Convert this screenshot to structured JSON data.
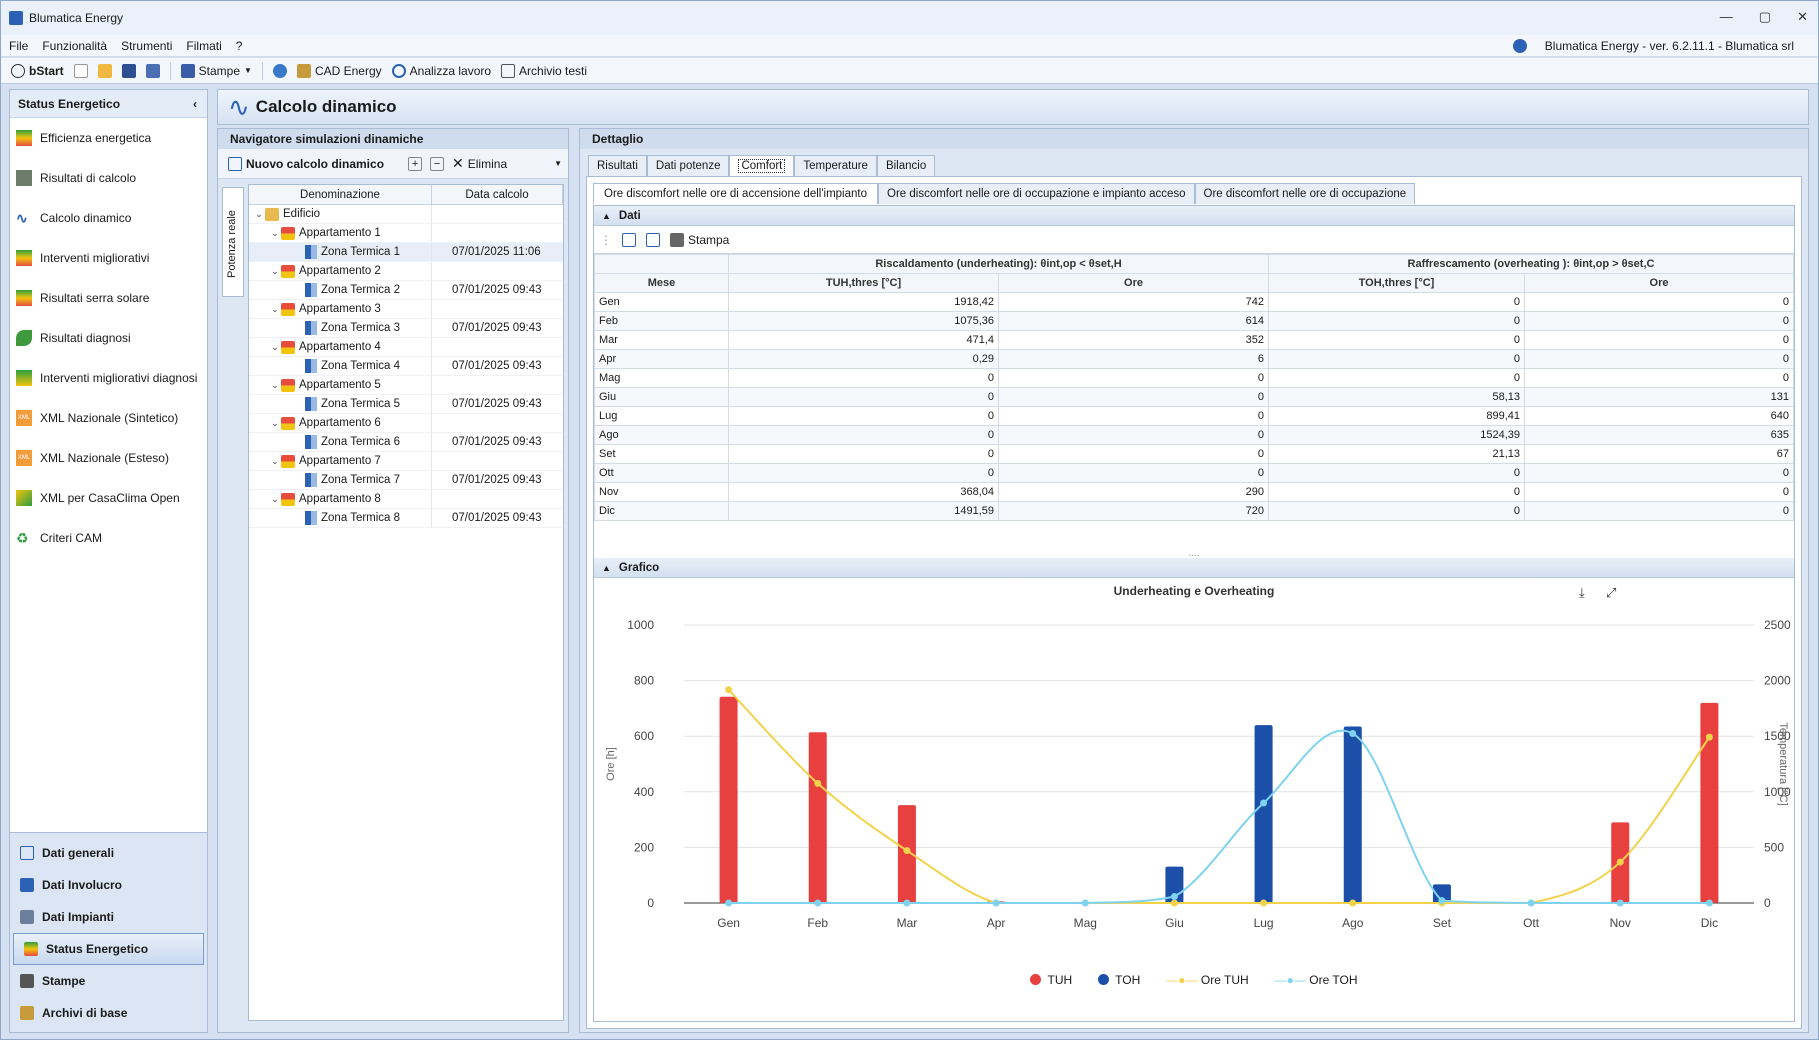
{
  "app": {
    "title": "Blumatica Energy",
    "version": "Blumatica Energy - ver. 6.2.11.1 - Blumatica srl"
  },
  "menu": [
    "File",
    "Funzionalità",
    "Strumenti",
    "Filmati",
    "?"
  ],
  "toolbar": {
    "bstart": "bStart",
    "stampe": "Stampe",
    "cad": "CAD Energy",
    "analizza": "Analizza lavoro",
    "archivio": "Archivio testi"
  },
  "sidebar": {
    "title": "Status Energetico",
    "items": [
      "Efficienza energetica",
      "Risultati di calcolo",
      "Calcolo dinamico",
      "Interventi migliorativi",
      "Risultati serra solare",
      "Risultati diagnosi",
      "Interventi migliorativi diagnosi",
      "XML Nazionale (Sintetico)",
      "XML Nazionale (Esteso)",
      "XML per CasaClima Open",
      "Criteri CAM"
    ],
    "bottom": [
      "Dati generali",
      "Dati Involucro",
      "Dati Impianti",
      "Status Energetico",
      "Stampe",
      "Archivi di base"
    ]
  },
  "main": {
    "title": "Calcolo dinamico"
  },
  "nav": {
    "title": "Navigatore simulazioni dinamiche",
    "new_btn": "Nuovo calcolo dinamico",
    "delete_btn": "Elimina",
    "vertical_tab": "Potenza reale",
    "col_name": "Denominazione",
    "col_date": "Data calcolo",
    "root": "Edificio",
    "apartments": [
      {
        "name": "Appartamento 1",
        "zone": "Zona Termica 1",
        "date": "07/01/2025 11:06"
      },
      {
        "name": "Appartamento 2",
        "zone": "Zona Termica 2",
        "date": "07/01/2025 09:43"
      },
      {
        "name": "Appartamento 3",
        "zone": "Zona Termica 3",
        "date": "07/01/2025 09:43"
      },
      {
        "name": "Appartamento 4",
        "zone": "Zona Termica 4",
        "date": "07/01/2025 09:43"
      },
      {
        "name": "Appartamento 5",
        "zone": "Zona Termica 5",
        "date": "07/01/2025 09:43"
      },
      {
        "name": "Appartamento 6",
        "zone": "Zona Termica 6",
        "date": "07/01/2025 09:43"
      },
      {
        "name": "Appartamento 7",
        "zone": "Zona Termica 7",
        "date": "07/01/2025 09:43"
      },
      {
        "name": "Appartamento 8",
        "zone": "Zona Termica 8",
        "date": "07/01/2025 09:43"
      }
    ]
  },
  "detail": {
    "title": "Dettaglio",
    "tabs": [
      "Risultati",
      "Dati potenze",
      "Comfort",
      "Temperature",
      "Bilancio"
    ],
    "subtabs": [
      "Ore discomfort nelle ore di accensione dell'impianto",
      "Ore discomfort nelle ore di occupazione e impianto acceso",
      "Ore discomfort nelle ore di occupazione"
    ],
    "dati": "Dati",
    "stampa": "Stampa",
    "grafico": "Grafico",
    "group_heat": "Riscaldamento (underheating):  θint,op < θset,H",
    "group_cool": "Raffrescamento (overheating ):  θint,op > θset,C",
    "col_mese": "Mese",
    "col_tuh": "TUH,thres [°C]",
    "col_ore": "Ore",
    "col_toh": "TOH,thres [°C]",
    "col_ore2": "Ore",
    "rows": [
      [
        "Gen",
        "1918,42",
        "742",
        "0",
        "0"
      ],
      [
        "Feb",
        "1075,36",
        "614",
        "0",
        "0"
      ],
      [
        "Mar",
        "471,4",
        "352",
        "0",
        "0"
      ],
      [
        "Apr",
        "0,29",
        "6",
        "0",
        "0"
      ],
      [
        "Mag",
        "0",
        "0",
        "0",
        "0"
      ],
      [
        "Giu",
        "0",
        "0",
        "58,13",
        "131"
      ],
      [
        "Lug",
        "0",
        "0",
        "899,41",
        "640"
      ],
      [
        "Ago",
        "0",
        "0",
        "1524,39",
        "635"
      ],
      [
        "Set",
        "0",
        "0",
        "21,13",
        "67"
      ],
      [
        "Ott",
        "0",
        "0",
        "0",
        "0"
      ],
      [
        "Nov",
        "368,04",
        "290",
        "0",
        "0"
      ],
      [
        "Dic",
        "1491,59",
        "720",
        "0",
        "0"
      ]
    ]
  },
  "chart_data": {
    "type": "bar",
    "title": "Underheating e Overheating",
    "categories": [
      "Gen",
      "Feb",
      "Mar",
      "Apr",
      "Mag",
      "Giu",
      "Lug",
      "Ago",
      "Set",
      "Ott",
      "Nov",
      "Dic"
    ],
    "ylabel": "Ore [h]",
    "y2label": "Temperatura [°C]",
    "ylim": [
      0,
      1000
    ],
    "y2lim": [
      0,
      2500
    ],
    "yticks": [
      "0",
      "200",
      "400",
      "600",
      "800",
      "1000"
    ],
    "y2ticks": [
      "0",
      "500",
      "1000",
      "1500",
      "2000",
      "2500"
    ],
    "series": [
      {
        "name": "TUH",
        "kind": "bar",
        "color": "#e8403e",
        "values": [
          742,
          614,
          352,
          6,
          0,
          0,
          0,
          0,
          0,
          0,
          290,
          720
        ]
      },
      {
        "name": "TOH",
        "kind": "bar",
        "color": "#1b4fa8",
        "values": [
          0,
          0,
          0,
          0,
          0,
          131,
          640,
          635,
          67,
          0,
          0,
          0
        ]
      },
      {
        "name": "Ore TUH",
        "kind": "line",
        "axis": "y2",
        "color": "#f2d24b",
        "values": [
          1918.42,
          1075.36,
          471.4,
          0.29,
          0,
          0,
          0,
          0,
          0,
          0,
          368.04,
          1491.59
        ]
      },
      {
        "name": "Ore TOH",
        "kind": "line",
        "axis": "y2",
        "color": "#7fd3f0",
        "values": [
          0,
          0,
          0,
          0,
          0,
          58.13,
          899.41,
          1524.39,
          21.13,
          0,
          0,
          0
        ]
      }
    ],
    "legend": "bottom"
  }
}
